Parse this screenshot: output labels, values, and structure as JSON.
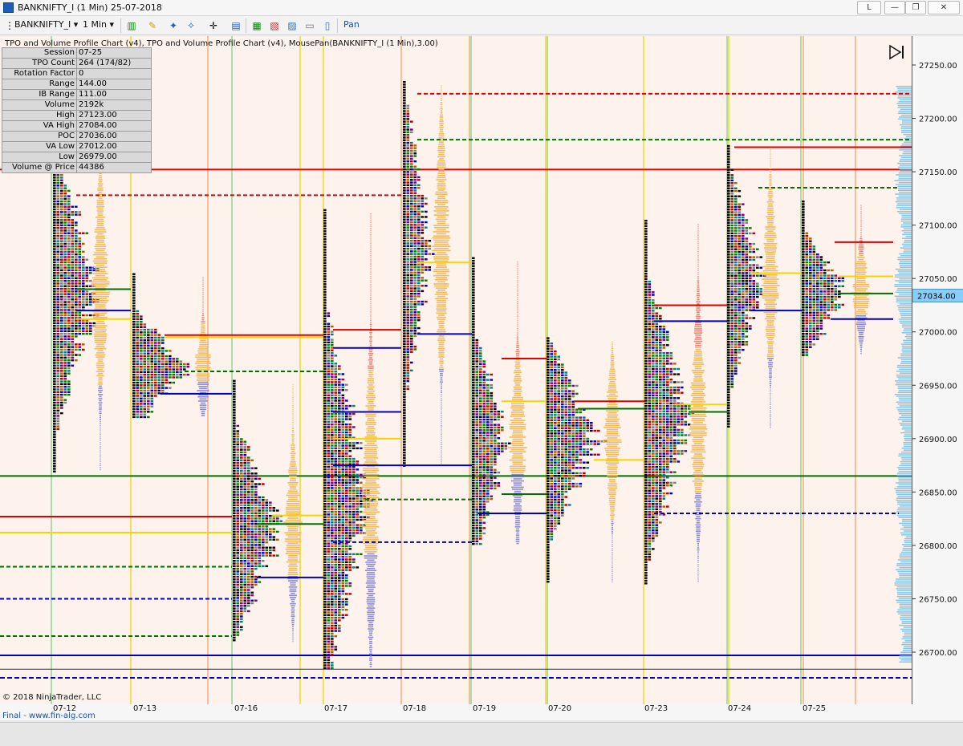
{
  "window": {
    "title": "BANKNIFTY_I (1 Min)  25-07-2018",
    "buttons": [
      "L",
      "—",
      "❐",
      "✕"
    ]
  },
  "toolbar": {
    "instrument": "BANKNIFTY_I",
    "interval": "1 Min",
    "mode": "Pan"
  },
  "chart_header": "TPO and Volume Profile Chart (v4),  TPO and Volume Profile Chart (v4), MousePan(BANKNIFTY_I (1 Min),3.00)",
  "info_rows": [
    {
      "label": "Session",
      "value": "07-25"
    },
    {
      "label": "TPO Count",
      "value": "264 (174/82)"
    },
    {
      "label": "Rotation Factor",
      "value": "0"
    },
    {
      "label": "Range",
      "value": "144.00"
    },
    {
      "label": "IB Range",
      "value": "111.00"
    },
    {
      "label": "Volume",
      "value": "2192k"
    },
    {
      "label": "High",
      "value": "27123.00"
    },
    {
      "label": "VA High",
      "value": "27084.00"
    },
    {
      "label": "POC",
      "value": "27036.00"
    },
    {
      "label": "VA Low",
      "value": "27012.00"
    },
    {
      "label": "Low",
      "value": "26979.00"
    },
    {
      "label": "Volume @ Price",
      "value": "44386"
    }
  ],
  "price_axis": {
    "ticks": [
      "27250.00",
      "27200.00",
      "27150.00",
      "27100.00",
      "27050.00",
      "27000.00",
      "26950.00",
      "26900.00",
      "26850.00",
      "26800.00",
      "26750.00",
      "26700.00"
    ],
    "current_price": "27034.00"
  },
  "dates": [
    "07-12",
    "07-13",
    "07-16",
    "07-17",
    "07-18",
    "07-19",
    "07-20",
    "07-23",
    "07-24",
    "07-25"
  ],
  "copyright": "© 2018 NinjaTrader, LLC",
  "footer_link": "Final - www.fin-alg.com",
  "colors": {
    "chart_bg": "#fdf3ec",
    "volume_orange": "#f5b85c",
    "volume_red": "#f08070",
    "volume_blue": "#8a8ad8",
    "line_red": "#e00000",
    "line_green": "#007000",
    "line_blue": "#0000c0",
    "line_yellow": "#f5d400",
    "current_price_bg": "#87cefa"
  },
  "chart_data": {
    "type": "market-profile",
    "ylim": [
      26670,
      27275
    ],
    "sessions": [
      {
        "date": "07-12",
        "high": 27190,
        "low": 26870
      },
      {
        "date": "07-13",
        "high": 27055,
        "low": 26920
      },
      {
        "date": "07-16",
        "high": 26955,
        "low": 26710
      },
      {
        "date": "07-17",
        "high": 27115,
        "low": 26685
      },
      {
        "date": "07-18",
        "high": 27235,
        "low": 26875
      },
      {
        "date": "07-19",
        "high": 27070,
        "low": 26800
      },
      {
        "date": "07-20",
        "high": 26995,
        "low": 26765
      },
      {
        "date": "07-23",
        "high": 27105,
        "low": 26765
      },
      {
        "date": "07-24",
        "high": 27175,
        "low": 26910
      },
      {
        "date": "07-25",
        "high": 27123,
        "low": 26979
      }
    ]
  }
}
